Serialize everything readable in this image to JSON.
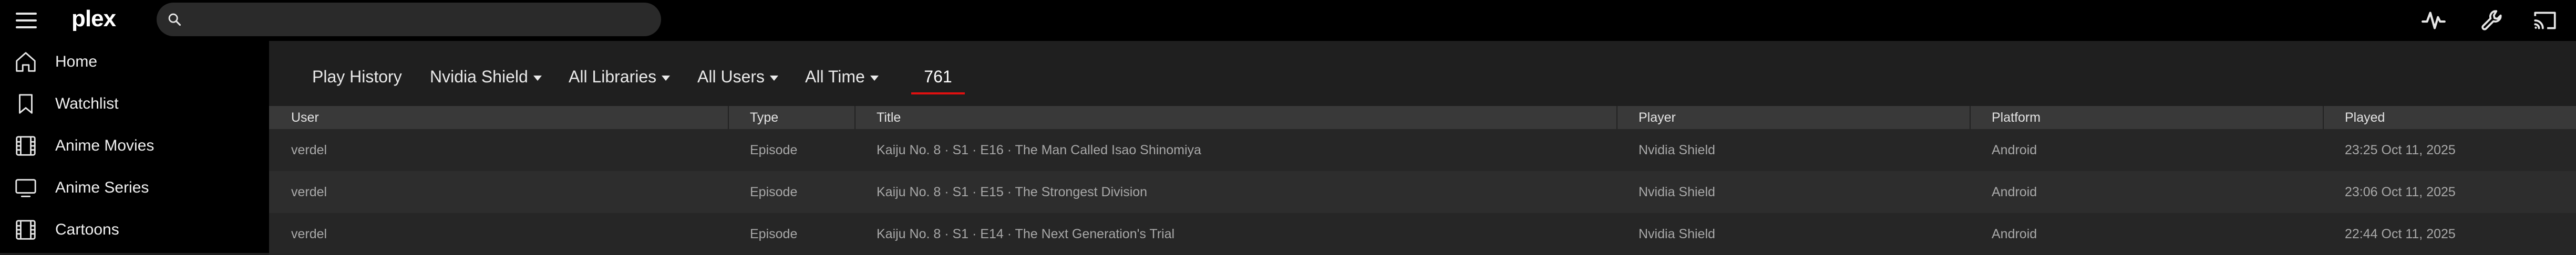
{
  "app": {
    "logo_text": "plex",
    "brand_accent": "#e5a00d",
    "tab_underline_color": "#e01010"
  },
  "topbar": {
    "search": {
      "value": "",
      "placeholder": ""
    },
    "icons": [
      "activity-icon",
      "wrench-icon",
      "cast-icon"
    ]
  },
  "sidebar": {
    "items": [
      {
        "label": "Home",
        "icon": "home-icon"
      },
      {
        "label": "Watchlist",
        "icon": "bookmark-icon"
      },
      {
        "label": "Anime Movies",
        "icon": "film-icon"
      },
      {
        "label": "Anime Series",
        "icon": "tv-icon"
      },
      {
        "label": "Cartoons",
        "icon": "film-icon"
      }
    ]
  },
  "filters": {
    "title": "Play History",
    "device": "Nvidia Shield",
    "libraries": "All Libraries",
    "users": "All Users",
    "time": "All Time",
    "count": "761"
  },
  "table": {
    "columns": [
      "User",
      "Type",
      "Title",
      "Player",
      "Platform",
      "Played"
    ],
    "rows": [
      {
        "user": "verdel",
        "type": "Episode",
        "title": "Kaiju No. 8 · S1 · E16 · The Man Called Isao Shinomiya",
        "player": "Nvidia Shield",
        "platform": "Android",
        "played": "23:25 Oct 11, 2025"
      },
      {
        "user": "verdel",
        "type": "Episode",
        "title": "Kaiju No. 8 · S1 · E15 · The Strongest Division",
        "player": "Nvidia Shield",
        "platform": "Android",
        "played": "23:06 Oct 11, 2025"
      },
      {
        "user": "verdel",
        "type": "Episode",
        "title": "Kaiju No. 8 · S1 · E14 · The Next Generation's Trial",
        "player": "Nvidia Shield",
        "platform": "Android",
        "played": "22:44 Oct 11, 2025"
      }
    ]
  }
}
